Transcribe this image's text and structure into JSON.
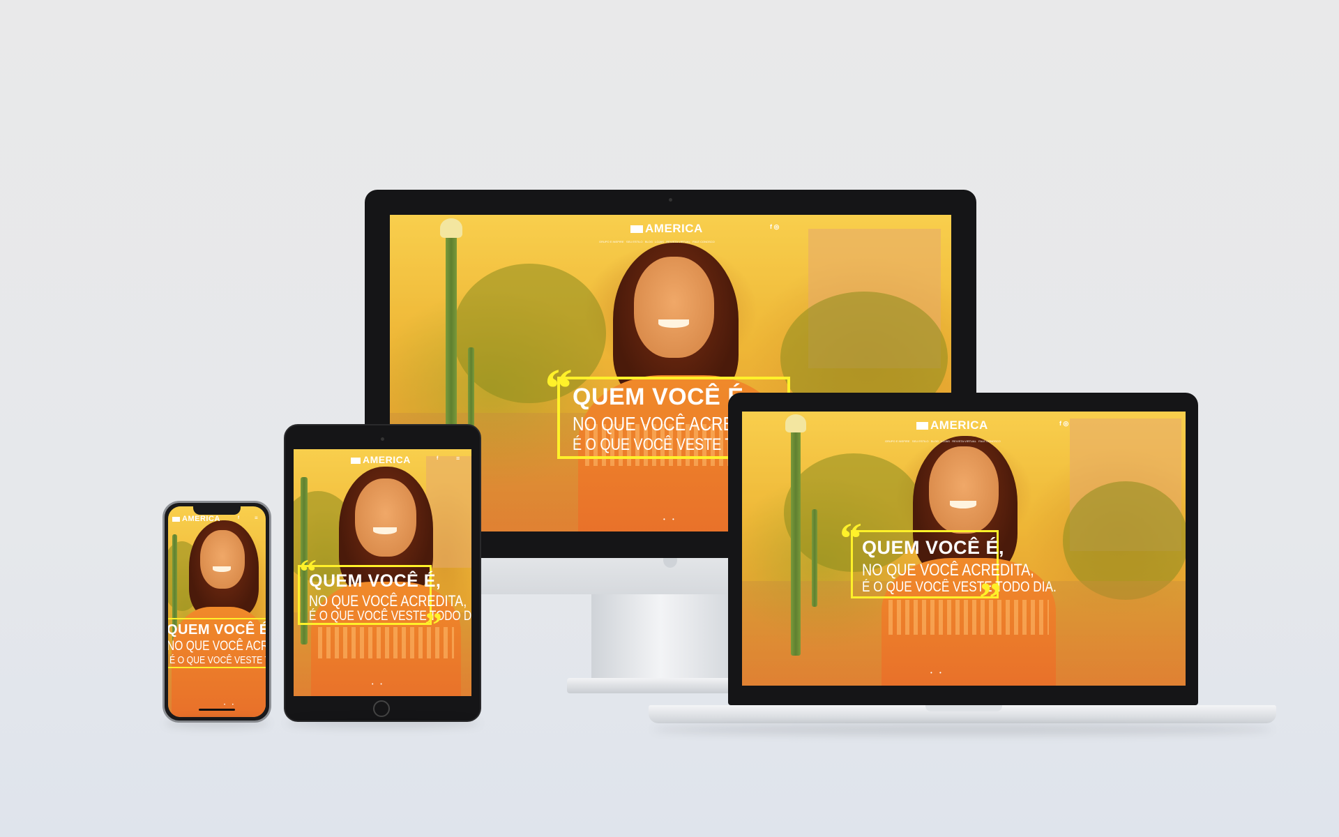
{
  "site": {
    "logo_text": "AMERICA",
    "nav_items": [
      "GRUPO E INSPIRE",
      "SEU ESTILO",
      "BLOG",
      "LOJAS",
      "REVISTA VIRTUAL",
      "FALE CONOSCO"
    ],
    "social_icons": [
      "facebook-icon",
      "instagram-icon"
    ],
    "headline": {
      "line1": "QUEM VOCÊ É,",
      "line2": "NO QUE VOCÊ ACREDITA,",
      "line3": "É O QUE VOCÊ VESTE TODO DIA."
    },
    "slider_dots": "• •"
  },
  "colors": {
    "overlay_yellow": "#f7d25a",
    "quote_yellow": "#fff12a",
    "dress_orange": "#f08a2a"
  }
}
